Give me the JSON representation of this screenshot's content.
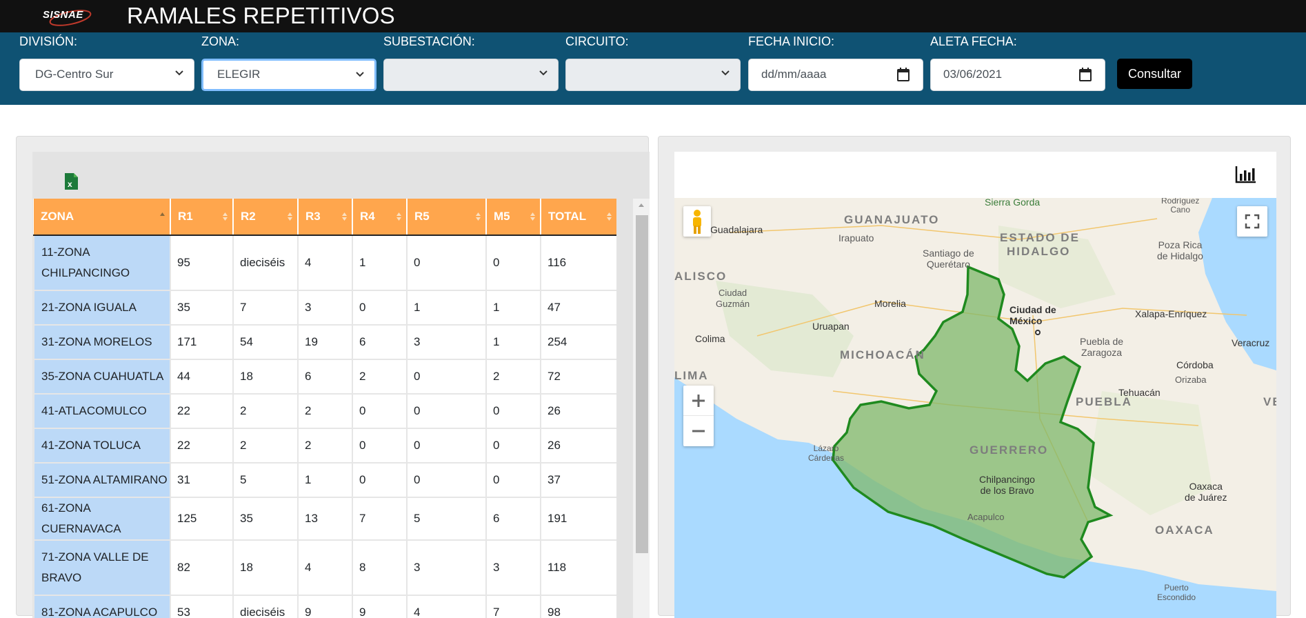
{
  "header": {
    "logo_text": "SISNAE",
    "title": "RAMALES REPETITIVOS"
  },
  "filters": {
    "division": {
      "label": "DIVISIÓN:",
      "value": "DG-Centro Sur"
    },
    "zona": {
      "label": "ZONA:",
      "value": "ELEGIR"
    },
    "subestacion": {
      "label": "SUBESTACIÓN:",
      "value": ""
    },
    "circuito": {
      "label": "CIRCUITO:",
      "value": ""
    },
    "fecha_inicio": {
      "label": "FECHA INICIO:",
      "value": "dd/mm/aaaa"
    },
    "aleta_fecha": {
      "label": "ALETA FECHA:",
      "value": "03/06/2021"
    },
    "consultar_label": "Consultar"
  },
  "table": {
    "columns": [
      "ZONA",
      "R1",
      "R2",
      "R3",
      "R4",
      "R5",
      "M5",
      "TOTAL"
    ],
    "rows": [
      [
        "11-ZONA CHILPANCINGO",
        "95",
        "dieciséis",
        "4",
        "1",
        "0",
        "0",
        "116"
      ],
      [
        "21-ZONA IGUALA",
        "35",
        "7",
        "3",
        "0",
        "1",
        "1",
        "47"
      ],
      [
        "31-ZONA MORELOS",
        "171",
        "54",
        "19",
        "6",
        "3",
        "1",
        "254"
      ],
      [
        "35-ZONA CUAHUATLA",
        "44",
        "18",
        "6",
        "2",
        "0",
        "2",
        "72"
      ],
      [
        "41-ATLACOMULCO",
        "22",
        "2",
        "2",
        "0",
        "0",
        "0",
        "26"
      ],
      [
        "41-ZONA TOLUCA",
        "22",
        "2",
        "2",
        "0",
        "0",
        "0",
        "26"
      ],
      [
        "51-ZONA ALTAMIRANO",
        "31",
        "5",
        "1",
        "0",
        "0",
        "0",
        "37"
      ],
      [
        "61-ZONA CUERNAVACA",
        "125",
        "35",
        "13",
        "7",
        "5",
        "6",
        "191"
      ],
      [
        "71-ZONA VALLE DE BRAVO",
        "82",
        "18",
        "4",
        "8",
        "3",
        "3",
        "118"
      ],
      [
        "81-ZONA ACAPULCO",
        "53",
        "dieciséis",
        "9",
        "9",
        "4",
        "7",
        "98"
      ]
    ]
  },
  "map": {
    "labels": {
      "guanajuato": "GUANAJUATO",
      "estado_de": "ESTADO DE",
      "hidalgo": "HIDALGO",
      "jalisco": "ALISCO",
      "michoacan": "MICHOACÁN",
      "puebla": "PUEBLA",
      "guerrero": "GUERRERO",
      "oaxaca": "OAXACA",
      "guadalajara": "Guadalajara",
      "irapuato": "Irapuato",
      "sierra_gorda": "Sierra Gorda",
      "rodriguez_cano": "Rodríguez\nCano",
      "santiago": "Santiago de\nQuerétaro",
      "poza_rica": "Poza Rica\nde Hidalgo",
      "ciudad_guzman": "Ciudad\nGuzmán",
      "morelia": "Morelia",
      "uruapan": "Uruapan",
      "cdmx": "Ciudad de\nMéxico",
      "xalapa": "Xalapa-Enríquez",
      "veracruz": "Veracruz",
      "colima": "Colima",
      "puebla_zaragoza": "Puebla de\nZaragoza",
      "cordoba": "Córdoba",
      "orizaba": "Orizaba",
      "tehuacan": "Tehuacán",
      "lima": "LIMA",
      "ve": "VE",
      "lazaro": "Lázaro\nCárdenas",
      "chilpancingo": "Chilpancingo\nde los Bravo",
      "acapulco": "Acapulco",
      "oaxaca_juarez": "Oaxaca\nde Juárez",
      "puerto_escondido": "Puerto\nEscondido"
    },
    "colors": {
      "region_fill": "#7fb86b",
      "region_border": "#1f8a1f",
      "water": "#aadaff",
      "land": "#f3efe6"
    }
  },
  "colors": {
    "topbar": "#111111",
    "filterbar": "#0f5273",
    "table_header": "#ffa64d",
    "zone_cell": "#bcd9f7",
    "excel_green": "#1d7a3a"
  }
}
